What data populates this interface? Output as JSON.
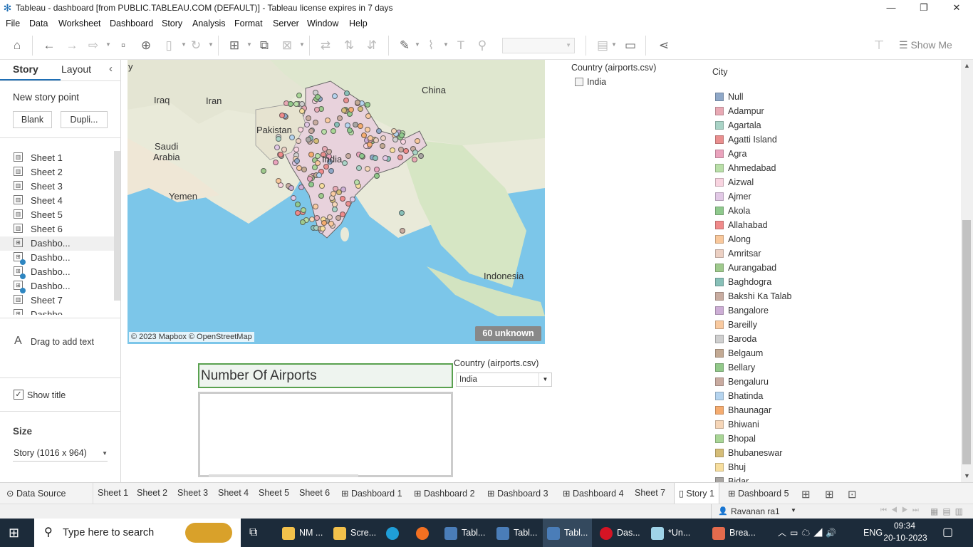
{
  "window": {
    "title": "Tableau - dashboard [from PUBLIC.TABLEAU.COM (DEFAULT)] - Tableau license expires in 7 days"
  },
  "menu": [
    "File",
    "Data",
    "Worksheet",
    "Dashboard",
    "Story",
    "Analysis",
    "Format",
    "Server",
    "Window",
    "Help"
  ],
  "toolbar": {
    "show_me": "Show Me"
  },
  "left_pane": {
    "tabs": [
      "Story",
      "Layout"
    ],
    "new_story_point": "New story point",
    "blank": "Blank",
    "duplicate": "Dupli...",
    "items": [
      "Sheet 1",
      "Sheet 2",
      "Sheet 3",
      "Sheet 4",
      "Sheet 5",
      "Sheet 6",
      "Dashbo...",
      "Dashbo...",
      "Dashbo...",
      "Dashbo...",
      "Sheet 7",
      "Dashbo..."
    ],
    "drag_text": "Drag to add text",
    "show_title": "Show title",
    "size_label": "Size",
    "size_value": "Story (1016 x 964)"
  },
  "map": {
    "labels": [
      "China",
      "Iraq",
      "Iran",
      "Pakistan",
      "Saudi",
      "Arabia",
      "India",
      "Yemen",
      "Indonesia",
      "y"
    ],
    "credit": "© 2023 Mapbox © OpenStreetMap",
    "unknown": "60 unknown"
  },
  "country_filter": {
    "title": "Country (airports.csv)",
    "value": "India"
  },
  "city_legend": {
    "title": "City",
    "items": [
      {
        "name": "Null",
        "color": "#8fa8c8"
      },
      {
        "name": "Adampur",
        "color": "#e8a9b4"
      },
      {
        "name": "Agartala",
        "color": "#a9d3c6"
      },
      {
        "name": "Agatti Island",
        "color": "#ea8f8f"
      },
      {
        "name": "Agra",
        "color": "#eaa3bd"
      },
      {
        "name": "Ahmedabad",
        "color": "#b9dfa8"
      },
      {
        "name": "Aizwal",
        "color": "#f8d4e0"
      },
      {
        "name": "Ajmer",
        "color": "#e2c9e6"
      },
      {
        "name": "Akola",
        "color": "#8fc98d"
      },
      {
        "name": "Allahabad",
        "color": "#f08a8a"
      },
      {
        "name": "Along",
        "color": "#f9c89c"
      },
      {
        "name": "Amritsar",
        "color": "#ecd0c3"
      },
      {
        "name": "Aurangabad",
        "color": "#9fca8d"
      },
      {
        "name": "Baghdogra",
        "color": "#88c0b8"
      },
      {
        "name": "Bakshi Ka Talab",
        "color": "#c8aca0"
      },
      {
        "name": "Bangalore",
        "color": "#cdaed6"
      },
      {
        "name": "Bareilly",
        "color": "#f9caa0"
      },
      {
        "name": "Baroda",
        "color": "#cfcfcf"
      },
      {
        "name": "Belgaum",
        "color": "#c3aa94"
      },
      {
        "name": "Bellary",
        "color": "#92c98a"
      },
      {
        "name": "Bengaluru",
        "color": "#c9aba0"
      },
      {
        "name": "Bhatinda",
        "color": "#b5d4ef"
      },
      {
        "name": "Bhaunagar",
        "color": "#f5ac70"
      },
      {
        "name": "Bhiwani",
        "color": "#f6d6b8"
      },
      {
        "name": "Bhopal",
        "color": "#a9d696"
      },
      {
        "name": "Bhubaneswar",
        "color": "#d5bd78"
      },
      {
        "name": "Bhuj",
        "color": "#f7de9e"
      },
      {
        "name": "Bidar",
        "color": "#a8a5a2"
      }
    ]
  },
  "kpi": {
    "title": "Number Of Airports"
  },
  "country_dropdown": {
    "label": "Country (airports.csv)",
    "value": "India"
  },
  "sheet_tabs": {
    "data_source": "Data Source",
    "tabs": [
      "Sheet 1",
      "Sheet 2",
      "Sheet 3",
      "Sheet 4",
      "Sheet 5",
      "Sheet 6",
      "Dashboard 1",
      "Dashboard 2",
      "Dashboard 3",
      "Dashboard 4",
      "Sheet 7",
      "Story 1",
      "Dashboard 5"
    ]
  },
  "status": {
    "user": "Ravanan ra1"
  },
  "taskbar": {
    "search": "Type here to search",
    "apps": [
      "NM ...",
      "Scre...",
      "Tabl...",
      "Tabl...",
      "Tabl...",
      "Das...",
      "*Un...",
      "Brea..."
    ],
    "lang": "ENG",
    "time": "09:34",
    "date": "20-10-2023"
  }
}
